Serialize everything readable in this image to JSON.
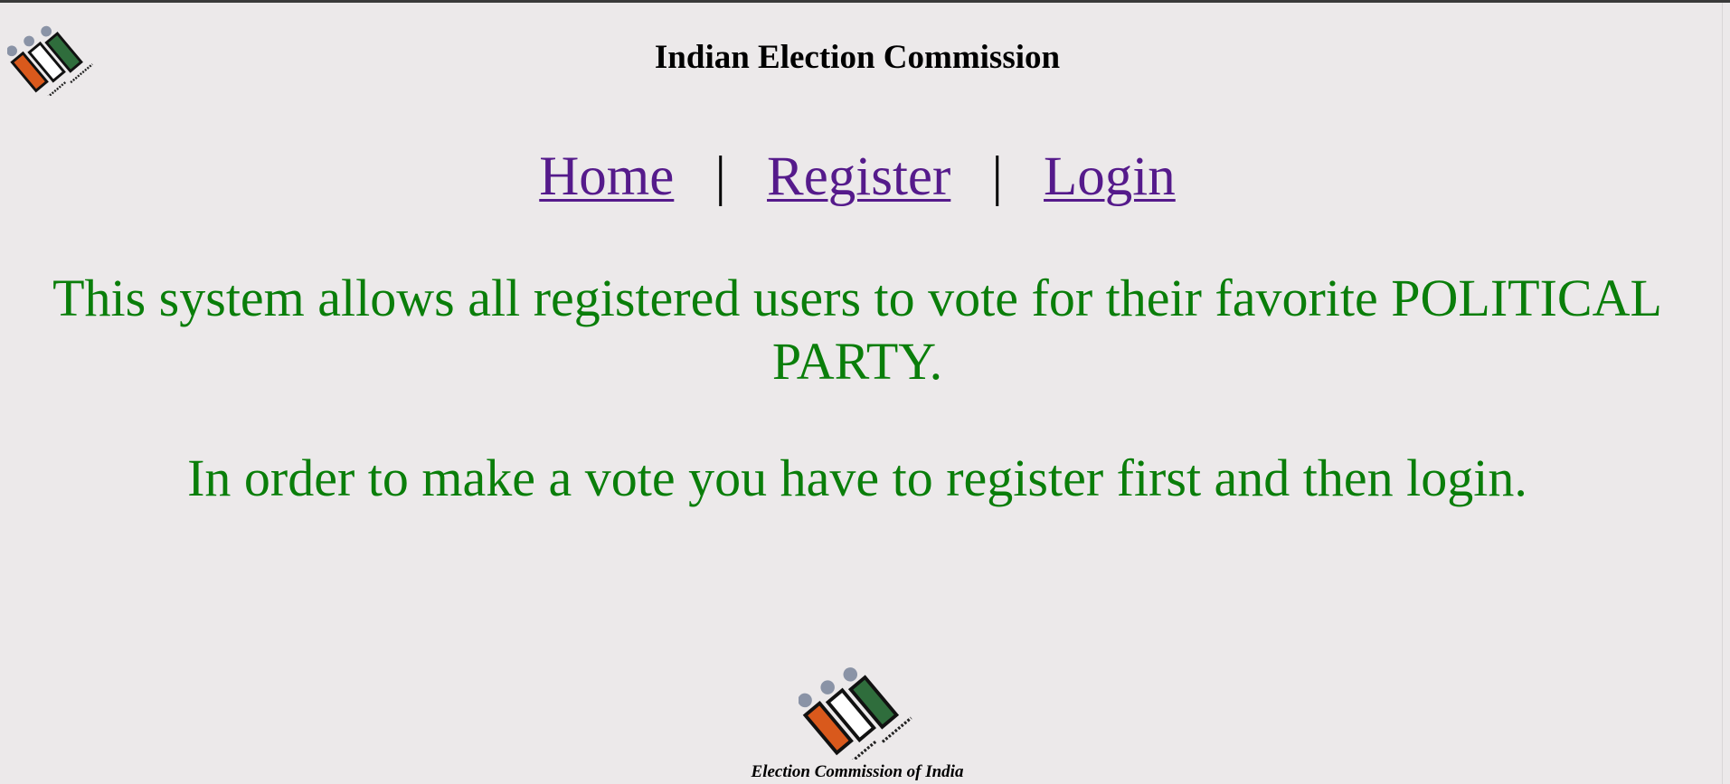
{
  "header": {
    "title": "Indian Election Commission"
  },
  "nav": {
    "items": [
      {
        "label": "Home"
      },
      {
        "label": "Register"
      },
      {
        "label": "Login"
      }
    ],
    "separator": "|"
  },
  "main": {
    "message_1": "This system allows all registered users to vote for their favorite POLITICAL PARTY.",
    "message_2": "In order to make a vote you have to register first and then login."
  },
  "footer": {
    "caption": "Election Commission of India"
  },
  "colors": {
    "background": "#ece9ea",
    "message_text": "#0a7e0a",
    "link": "#551a8b",
    "logo_orange": "#d9591c",
    "logo_green": "#2f6d3c",
    "logo_dot": "#8a93a6"
  },
  "icons": {
    "logo": "eci-ballot-logo-icon"
  }
}
